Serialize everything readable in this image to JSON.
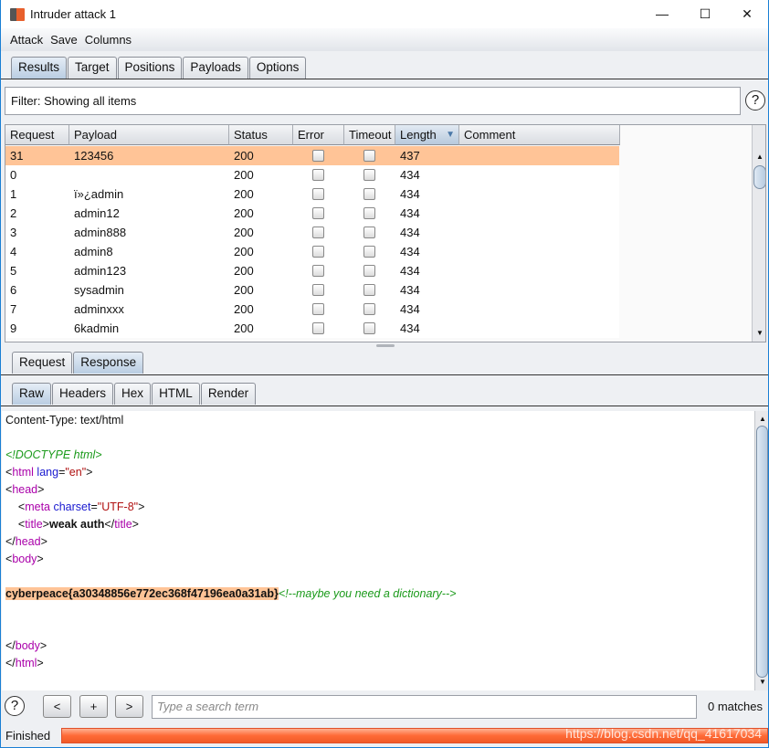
{
  "window": {
    "title": "Intruder attack 1",
    "controls": [
      "—",
      "☐",
      "✕"
    ]
  },
  "menu": [
    "Attack",
    "Save",
    "Columns"
  ],
  "main_tabs": [
    {
      "label": "Results",
      "selected": true
    },
    {
      "label": "Target"
    },
    {
      "label": "Positions"
    },
    {
      "label": "Payloads"
    },
    {
      "label": "Options"
    }
  ],
  "filter": "Filter: Showing all items",
  "help": "?",
  "table": {
    "columns": [
      "Request",
      "Payload",
      "Status",
      "Error",
      "Timeout",
      "Length",
      "Comment"
    ],
    "sort_indicator": "▼",
    "rows": [
      {
        "request": "31",
        "payload": "123456",
        "status": "200",
        "length": "437",
        "highlight": true
      },
      {
        "request": "0",
        "payload": "",
        "status": "200",
        "length": "434"
      },
      {
        "request": "1",
        "payload": "ï»¿admin",
        "status": "200",
        "length": "434"
      },
      {
        "request": "2",
        "payload": "admin12",
        "status": "200",
        "length": "434"
      },
      {
        "request": "3",
        "payload": "admin888",
        "status": "200",
        "length": "434"
      },
      {
        "request": "4",
        "payload": "admin8",
        "status": "200",
        "length": "434"
      },
      {
        "request": "5",
        "payload": "admin123",
        "status": "200",
        "length": "434"
      },
      {
        "request": "6",
        "payload": "sysadmin",
        "status": "200",
        "length": "434"
      },
      {
        "request": "7",
        "payload": "adminxxx",
        "status": "200",
        "length": "434"
      },
      {
        "request": "9",
        "payload": "6kadmin",
        "status": "200",
        "length": "434"
      }
    ]
  },
  "rr_tabs": [
    {
      "label": "Request"
    },
    {
      "label": "Response",
      "selected": true
    }
  ],
  "view_tabs": [
    {
      "label": "Raw",
      "selected": true
    },
    {
      "label": "Headers"
    },
    {
      "label": "Hex"
    },
    {
      "label": "HTML"
    },
    {
      "label": "Render"
    }
  ],
  "response": {
    "content_type": "Content-Type: text/html",
    "doctype": "<!DOCTYPE html>",
    "html_tag": "html",
    "lang_attr": "lang",
    "lang_val": "\"en\"",
    "head_tag": "head",
    "meta_tag": "meta",
    "charset_attr": "charset",
    "charset_val": "\"UTF-8\"",
    "title_tag": "title",
    "title_text": "weak auth",
    "body_tag": "body",
    "flag": "cyberpeace{a30348856e772ec368f47196ea0a31ab}",
    "comment": "<!--maybe you need a dictionary-->"
  },
  "search": {
    "placeholder": "Type a search term",
    "prev": "<",
    "add": "+",
    "next": ">",
    "matches": "0 matches"
  },
  "status": {
    "label": "Finished",
    "progress": 100,
    "color": "#ff6a36"
  },
  "watermark": "https://blog.csdn.net/qq_41617034",
  "colors": {
    "highlight": "#ffc497",
    "accent": "#1a7fd4"
  }
}
